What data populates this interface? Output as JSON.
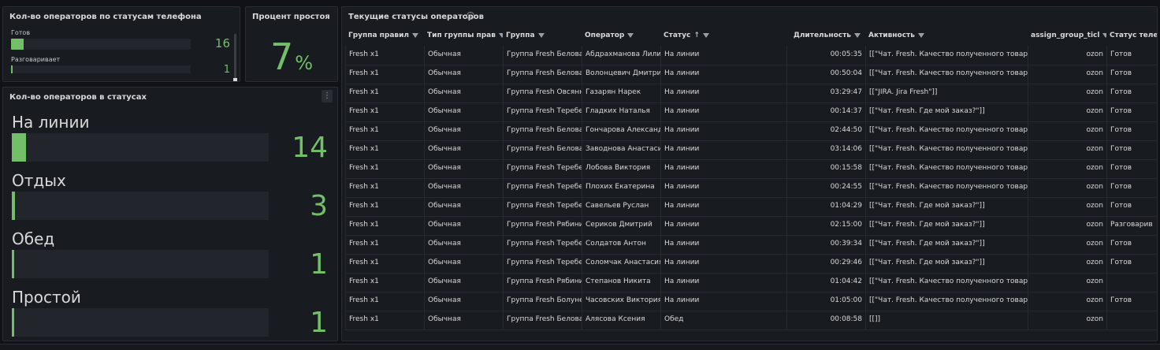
{
  "panels": {
    "phone_status": {
      "title": "Кол-во операторов по статусам телефона",
      "items": [
        {
          "label": "Готов",
          "value": "16",
          "fraction": 0.07
        },
        {
          "label": "Разговаривает",
          "value": "1",
          "fraction": 0.005
        }
      ]
    },
    "idle_percent": {
      "title": "Процент простоя",
      "value": "7",
      "unit": "%"
    },
    "status_counts": {
      "title": "Кол-во операторов в статусах",
      "items": [
        {
          "label": "На линии",
          "value": "14",
          "fraction": 0.055
        },
        {
          "label": "Отдых",
          "value": "3",
          "fraction": 0.012
        },
        {
          "label": "Обед",
          "value": "1",
          "fraction": 0.004
        },
        {
          "label": "Простой",
          "value": "1",
          "fraction": 0.004
        }
      ]
    },
    "operators_table": {
      "title": "Текущие статусы операторов",
      "columns": [
        "Группа правил",
        "Тип группы прав",
        "Группа",
        "Оператор",
        "Статус",
        "Длительность",
        "Активность",
        "assign_group_ticl",
        "Статус теле"
      ],
      "rows": [
        [
          "Fresh x1",
          "Обычная",
          "Группа Fresh Белова",
          "Абдрахманова Лилия",
          "На линии",
          "00:05:35",
          "[[\"Чат. Fresh. Качество полученного товара",
          "ozon",
          "Готов"
        ],
        [
          "Fresh x1",
          "Обычная",
          "Группа Fresh Белова",
          "Волонцевич Дмитрий",
          "На линии",
          "00:50:04",
          "[[\"Чат. Fresh. Качество полученного товара",
          "ozon",
          "Готов"
        ],
        [
          "Fresh x1",
          "Обычная",
          "Группа Fresh Овсянн",
          "Газарян Нарек",
          "На линии",
          "03:29:47",
          "[[\"JIRA. Jira Fresh\"]]",
          "ozon",
          "Готов"
        ],
        [
          "Fresh x1",
          "Обычная",
          "Группа Fresh Теребе",
          "Гладких Наталья",
          "На линии",
          "00:14:37",
          "[[\"Чат. Fresh. Где мой заказ?\"]]",
          "ozon",
          "Готов"
        ],
        [
          "Fresh x1",
          "Обычная",
          "Группа Fresh Белова",
          "Гончарова Александра",
          "На линии",
          "02:44:50",
          "[[\"Чат. Fresh. Качество полученного товара",
          "ozon",
          "Готов"
        ],
        [
          "Fresh x1",
          "Обычная",
          "Группа Fresh Белова",
          "Заводнова Анастасия",
          "На линии",
          "03:14:06",
          "[[\"Чат. Fresh. Качество полученного товара",
          "ozon",
          "Готов"
        ],
        [
          "Fresh x1",
          "Обычная",
          "Группа Fresh Теребе",
          "Лобова Виктория",
          "На линии",
          "00:15:58",
          "[[\"Чат. Fresh. Качество полученного товара",
          "ozon",
          "Готов"
        ],
        [
          "Fresh x1",
          "Обычная",
          "Группа Fresh Теребе",
          "Плохих Екатерина",
          "На линии",
          "00:24:55",
          "[[\"Чат. Fresh. Качество полученного товара",
          "ozon",
          "Готов"
        ],
        [
          "Fresh x1",
          "Обычная",
          "Группа Fresh Теребе",
          "Савельев Руслан",
          "На линии",
          "01:04:29",
          "[[\"Чат. Fresh. Где мой заказ?\"]]",
          "ozon",
          "Готов"
        ],
        [
          "Fresh x1",
          "Обычная",
          "Группа Fresh Рябини",
          "Сериков Дмитрий",
          "На линии",
          "02:15:00",
          "[[\"Чат. Fresh. Где мой заказ?\"]]",
          "ozon",
          "Разговарив"
        ],
        [
          "Fresh x1",
          "Обычная",
          "Группа Fresh Теребе",
          "Солдатов Антон",
          "На линии",
          "00:39:34",
          "[[\"Чат. Fresh. Где мой заказ?\"]]",
          "ozon",
          "Готов"
        ],
        [
          "Fresh x1",
          "Обычная",
          "Группа Fresh Теребе",
          "Соломчак Анастасия",
          "На линии",
          "00:29:46",
          "[[\"Чат. Fresh. Где мой заказ?\"]]",
          "ozon",
          "Готов"
        ],
        [
          "Fresh x1",
          "Обычная",
          "Группа Fresh Рябини",
          "Степанов Никита",
          "На линии",
          "01:04:42",
          "[[\"Чат. Fresh. Качество полученного товара",
          "ozon",
          ""
        ],
        [
          "Fresh x1",
          "Обычная",
          "Группа Fresh Болуне",
          "Часовских Виктория",
          "На линии",
          "01:05:00",
          "[[\"Чат. Fresh. Качество полученного товара",
          "ozon",
          "Готов"
        ],
        [
          "Fresh x1",
          "Обычная",
          "Группа Fresh Белова",
          "Алясова Ксения",
          "Обед",
          "00:08:58",
          "[[]]",
          "ozon",
          ""
        ]
      ]
    }
  },
  "colors": {
    "accent_green": "#73bf69",
    "panel_bg": "#181b1f",
    "page_bg": "#111217"
  },
  "icons": {
    "filter": "filter-icon",
    "sort": "sort-ascending-icon",
    "info": "info-icon",
    "menu": "panel-menu-icon"
  }
}
